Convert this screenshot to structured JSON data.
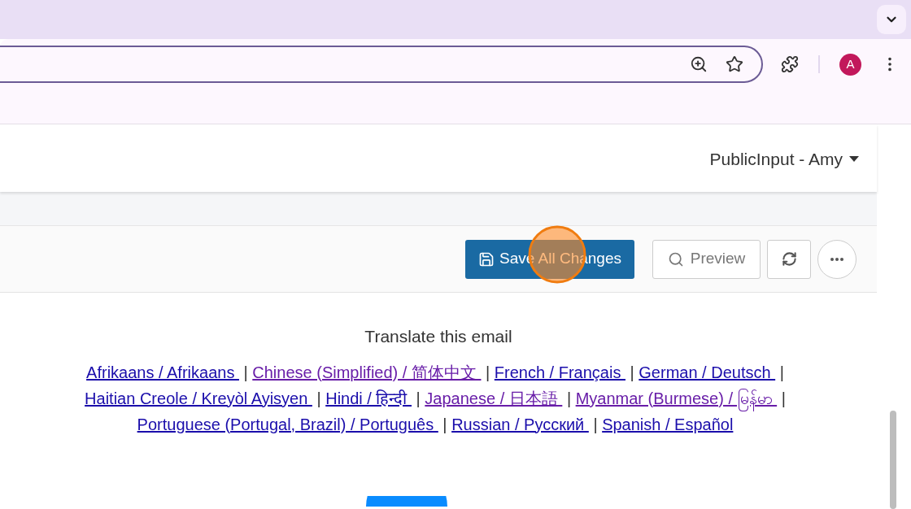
{
  "browser": {
    "profile_initial": "A"
  },
  "header": {
    "account_menu": "PublicInput - Amy"
  },
  "toolbar": {
    "save_button": "Save All Changes",
    "preview_button": "Preview"
  },
  "email": {
    "heading": "Translate this email",
    "languages": [
      {
        "label": "Afrikaans / Afrikaans ",
        "visited": false
      },
      {
        "label": "Chinese (Simplified) / 简体中文 ",
        "visited": true
      },
      {
        "label": "French / Français ",
        "visited": false
      },
      {
        "label": "German / Deutsch ",
        "visited": false
      },
      {
        "label": "Haitian Creole / Kreyòl Ayisyen ",
        "visited": false
      },
      {
        "label": "Hindi / हिन्दी ",
        "visited": false
      },
      {
        "label": "Japanese / 日本語 ",
        "visited": true
      },
      {
        "label": "Myanmar (Burmese) / မြန်မာ ",
        "visited": true
      },
      {
        "label": "Portuguese (Portugal, Brazil) / Português ",
        "visited": false
      },
      {
        "label": "Russian / Русский ",
        "visited": false
      },
      {
        "label": "Spanish / Español",
        "visited": false
      }
    ],
    "separator": "|"
  }
}
